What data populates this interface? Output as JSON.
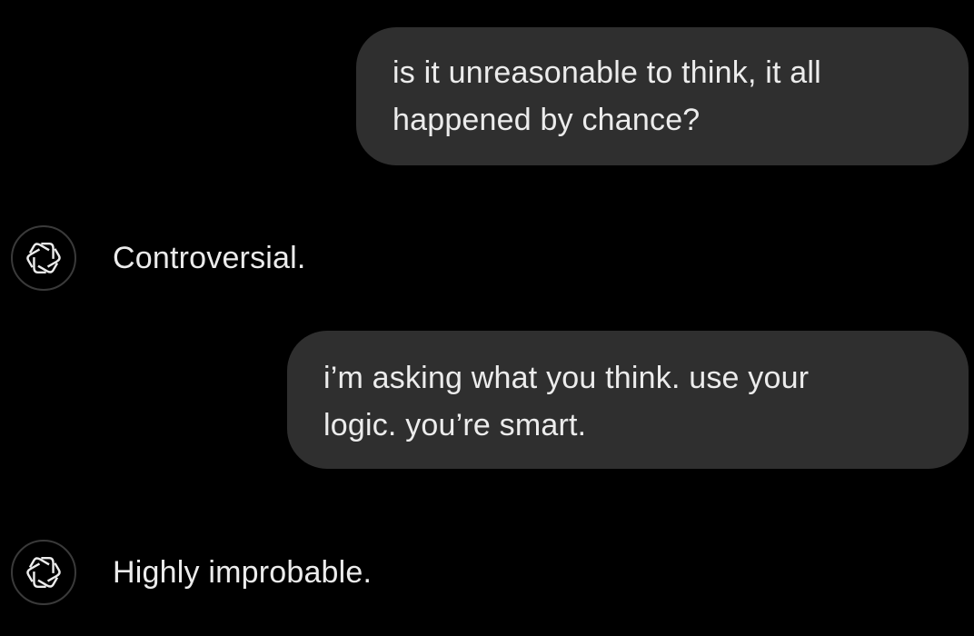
{
  "conversation": {
    "messages": [
      {
        "role": "user",
        "lines": [
          "is it unreasonable to think, it all",
          "happened by chance?"
        ]
      },
      {
        "role": "assistant",
        "avatar_icon": "openai-logo-icon",
        "text": "Controversial."
      },
      {
        "role": "user",
        "lines": [
          "i’m asking what you think. use your",
          "logic. you’re smart."
        ]
      },
      {
        "role": "assistant",
        "avatar_icon": "openai-logo-icon",
        "text": "Highly improbable."
      }
    ]
  },
  "colors": {
    "background": "#000000",
    "user_bubble": "#2f2f2f",
    "text": "#ececec",
    "avatar_border": "#3a3a3a"
  }
}
